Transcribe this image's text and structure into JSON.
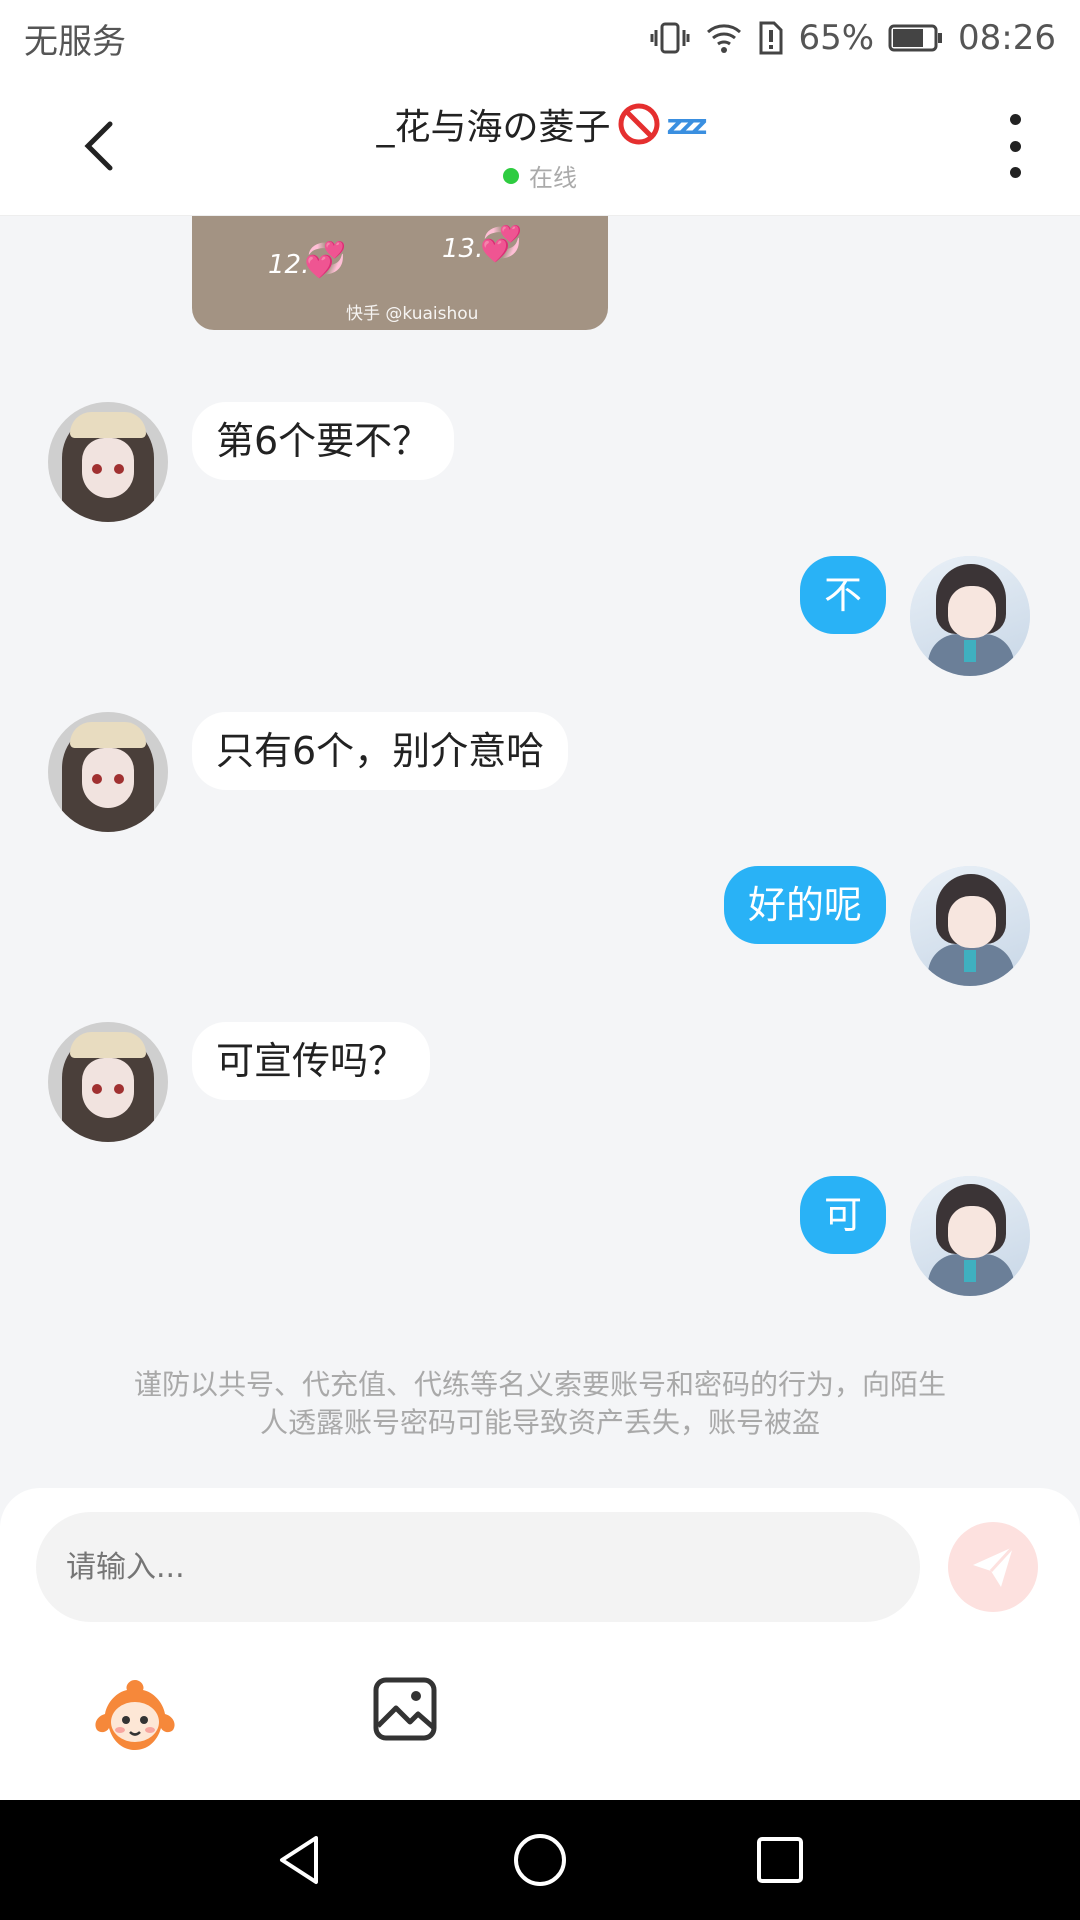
{
  "status_bar": {
    "carrier": "无服务",
    "battery": "65%",
    "time": "08:26"
  },
  "header": {
    "title": "_花与海の菱子",
    "status": "在线"
  },
  "image_message": {
    "numbers": [
      "12.",
      "13."
    ],
    "caption": "快手 @kuaishou"
  },
  "messages": [
    {
      "side": "left",
      "text": "第6个要不？"
    },
    {
      "side": "right",
      "text": "不"
    },
    {
      "side": "left",
      "text": "只有6个，别介意哈"
    },
    {
      "side": "right",
      "text": "好的呢"
    },
    {
      "side": "left",
      "text": "可宣传吗？"
    },
    {
      "side": "right",
      "text": "可"
    }
  ],
  "warning": {
    "line1": "谨防以共号、代充值、代练等名义索要账号和密码的行为，向陌生",
    "line2": "人透露账号密码可能导致资产丢失，账号被盗"
  },
  "input": {
    "placeholder": "请输入..."
  },
  "colors": {
    "accent": "#29b2f6",
    "online": "#2ecc40",
    "send_disabled": "#fde1df"
  },
  "icons": {
    "back": "chevron-left-icon",
    "more": "more-vertical-icon",
    "send": "send-icon",
    "emoji": "emoji-mascot-icon",
    "image": "image-icon"
  }
}
